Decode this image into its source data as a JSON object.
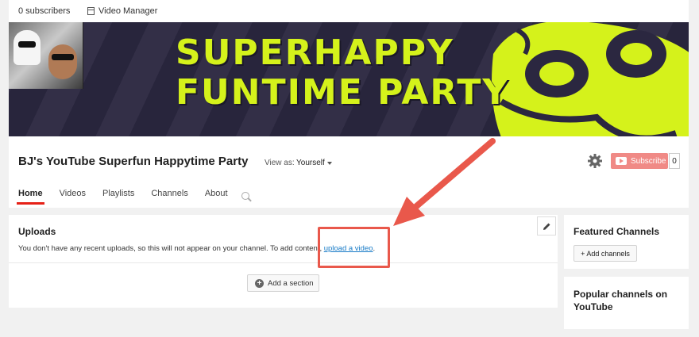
{
  "topbar": {
    "subscribers": "0 subscribers",
    "video_manager": "Video Manager"
  },
  "banner": {
    "line1": "SUPERHAPPY",
    "line2": "FUNTIME PARTY",
    "accent": "#d5f21b"
  },
  "channel": {
    "name": "BJ's YouTube Superfun Happytime Party",
    "view_as_label": "View as:",
    "view_as_value": "Yourself",
    "subscribe_label": "Subscribe",
    "subscribe_count": "0"
  },
  "tabs": [
    "Home",
    "Videos",
    "Playlists",
    "Channels",
    "About"
  ],
  "uploads": {
    "title": "Uploads",
    "desc_before": "You don't have any recent uploads, so this will not appear on your channel. To add content, ",
    "link": "upload a video",
    "desc_after": ".",
    "add_section": "Add a section"
  },
  "sidebar": {
    "featured_title": "Featured Channels",
    "add_channels": "+ Add channels",
    "popular_title": "Popular channels on YouTube"
  },
  "colors": {
    "subscribe": "#f08a86",
    "annotation": "#e9584b",
    "active_tab": "#e62117"
  }
}
